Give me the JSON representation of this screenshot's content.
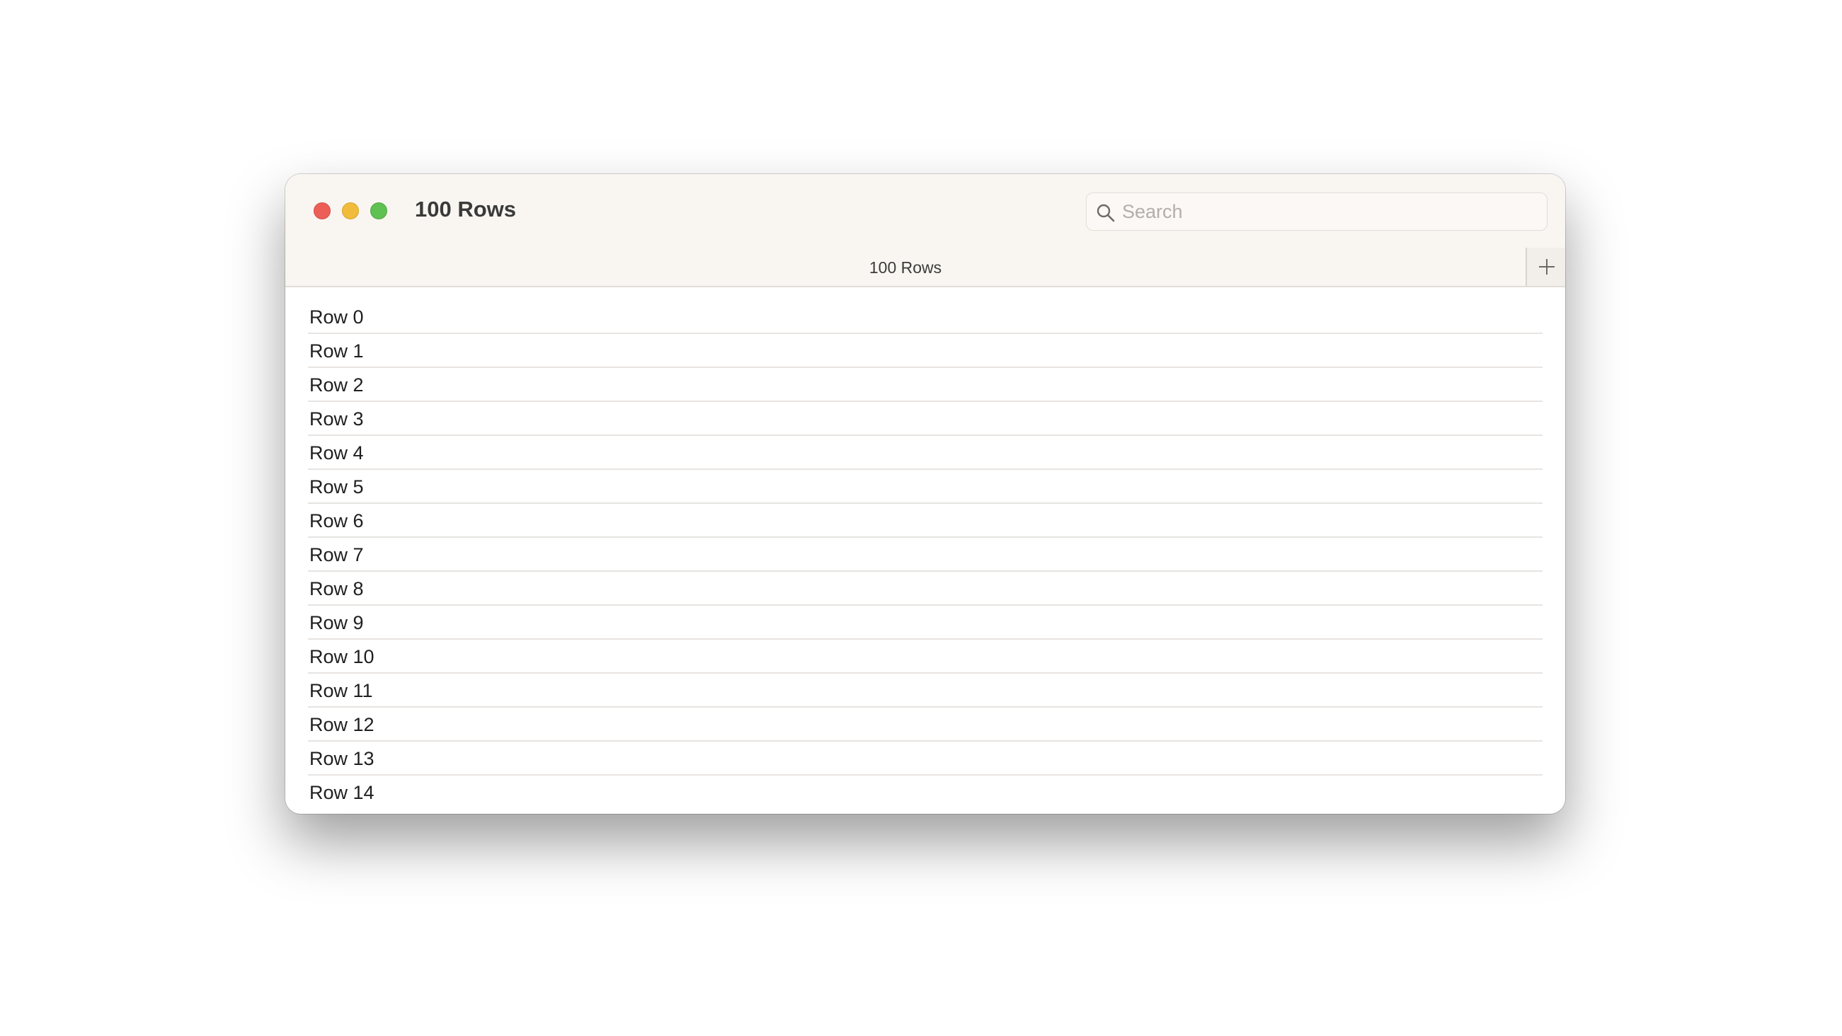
{
  "window": {
    "title": "100 Rows",
    "controls": [
      "close",
      "minimize",
      "zoom"
    ]
  },
  "search": {
    "placeholder": "Search",
    "value": ""
  },
  "tabbar": {
    "tab_label": "100 Rows",
    "new_tab_icon": "plus-icon"
  },
  "list": {
    "rows": [
      "Row 0",
      "Row 1",
      "Row 2",
      "Row 3",
      "Row 4",
      "Row 5",
      "Row 6",
      "Row 7",
      "Row 8",
      "Row 9",
      "Row 10",
      "Row 11",
      "Row 12",
      "Row 13",
      "Row 14"
    ]
  },
  "colors": {
    "close": "#ec5f57",
    "minimize": "#f1bc3b",
    "zoom": "#5fc152",
    "chrome_background": "#f9f5f1"
  }
}
